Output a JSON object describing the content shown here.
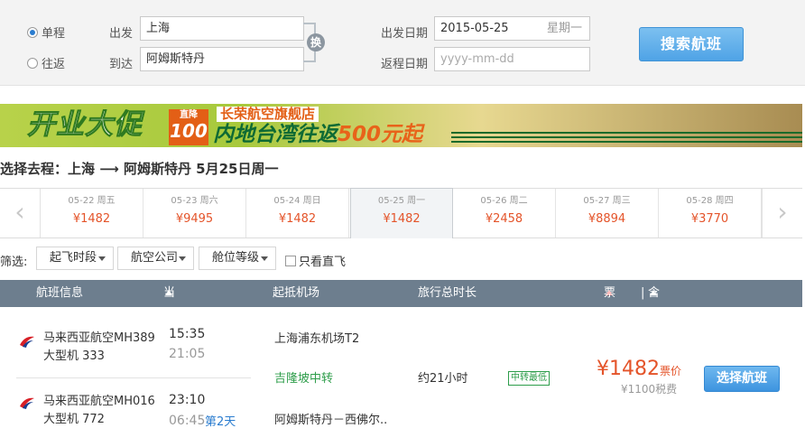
{
  "search": {
    "trip_types": [
      {
        "label": "单程",
        "selected": true
      },
      {
        "label": "往返",
        "selected": false
      }
    ],
    "from_label": "出发",
    "from_value": "上海",
    "to_label": "到达",
    "to_value": "阿姆斯特丹",
    "swap_label": "换",
    "depart_date_label": "出发日期",
    "depart_date_value": "2015-05-25",
    "depart_weekday": "星期一",
    "return_date_label": "返程日期",
    "return_date_placeholder": "yyyy-mm-dd",
    "search_button": "搜索航班"
  },
  "banner": {
    "main_text": "开业大促",
    "badge_small": "直降",
    "badge_number": "100",
    "store_tag": "长荣航空旗舰店",
    "sub_text_prefix": "内地台湾往返",
    "sub_text_price": "500元起"
  },
  "route_title": "选择去程：上海 ⟶ 阿姆斯特丹  5月25日周一",
  "date_strip": {
    "dates": [
      {
        "date": "05-22",
        "weekday": "周五",
        "price": "¥1482",
        "active": false
      },
      {
        "date": "05-23",
        "weekday": "周六",
        "price": "¥9495",
        "active": false
      },
      {
        "date": "05-24",
        "weekday": "周日",
        "price": "¥1482",
        "active": false
      },
      {
        "date": "05-25",
        "weekday": "周一",
        "price": "¥1482",
        "active": true
      },
      {
        "date": "05-26",
        "weekday": "周二",
        "price": "¥2458",
        "active": false
      },
      {
        "date": "05-27",
        "weekday": "周三",
        "price": "¥8894",
        "active": false
      },
      {
        "date": "05-28",
        "weekday": "周四",
        "price": "¥3770",
        "active": false
      }
    ],
    "prev_icon": "chevron-left",
    "next_icon": "chevron-right"
  },
  "filter": {
    "label": "筛选:",
    "dropdowns": [
      "起飞时段",
      "航空公司",
      "舱位等级"
    ],
    "direct_only_label": "只看直飞"
  },
  "table_header": {
    "flight_info": "航班信息",
    "local_time": "当地起降时间",
    "airports": "起抵机场",
    "duration": "旅行总时长",
    "price": "票价",
    "divider": "|",
    "tax_price": "含税价"
  },
  "flight": {
    "legs": [
      {
        "airline_flight": "马来西亚航空MH389",
        "aircraft": "大型机 333",
        "depart_time": "15:35",
        "arrive_time": "21:05",
        "next_day": ""
      },
      {
        "airline_flight": "马来西亚航空MH016",
        "aircraft": "大型机 772",
        "depart_time": "23:10",
        "arrive_time": "06:45",
        "next_day": "第2天"
      }
    ],
    "depart_airport": "上海浦东机场T2",
    "transfer": "吉隆坡中转",
    "arrive_airport": "阿姆斯特丹－西佛尔..",
    "duration": "约21小时",
    "badge": "中转最低",
    "price_symbol": "¥",
    "price": "1482",
    "price_suffix": "票价",
    "tax": "¥1100税费",
    "select_button": "选择航班"
  },
  "colors": {
    "price_red": "#e4542a",
    "accent_blue": "#4fa3e6",
    "header_gray": "#6d7e8e",
    "transfer_green": "#2d9d4a"
  }
}
